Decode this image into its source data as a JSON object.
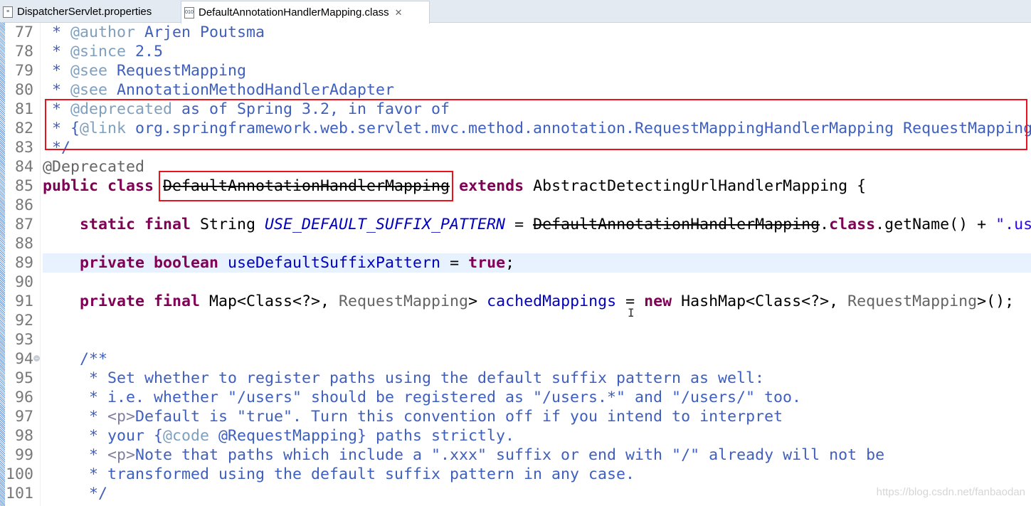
{
  "tabs": [
    {
      "label": "DispatcherServlet.properties",
      "active": false
    },
    {
      "label": "DefaultAnnotationHandlerMapping.class",
      "active": true,
      "icon": "class-file-icon",
      "close": "✕"
    }
  ],
  "editor": {
    "highlighted_line": 89,
    "folded_marker_line": 94,
    "lines": [
      {
        "n": "77",
        "tokens": [
          [
            " * ",
            "jd"
          ],
          [
            "@author",
            "tag"
          ],
          [
            " Arjen Poutsma",
            "jd"
          ]
        ]
      },
      {
        "n": "78",
        "tokens": [
          [
            " * ",
            "jd"
          ],
          [
            "@since",
            "tag"
          ],
          [
            " 2.5",
            "jd"
          ]
        ]
      },
      {
        "n": "79",
        "tokens": [
          [
            " * ",
            "jd"
          ],
          [
            "@see",
            "tag"
          ],
          [
            " RequestMapping",
            "jd"
          ]
        ]
      },
      {
        "n": "80",
        "tokens": [
          [
            " * ",
            "jd"
          ],
          [
            "@see",
            "tag"
          ],
          [
            " AnnotationMethodHandlerAdapter",
            "jd"
          ]
        ]
      },
      {
        "n": "81",
        "tokens": [
          [
            " * ",
            "jd"
          ],
          [
            "@deprecated",
            "tag"
          ],
          [
            " as of Spring 3.2, in favor of",
            "jd"
          ]
        ]
      },
      {
        "n": "82",
        "tokens": [
          [
            " * {",
            "jd"
          ],
          [
            "@link",
            "tag"
          ],
          [
            " org.springframework.web.servlet.mvc.method.annotation.RequestMappingHandlerMapping RequestMapping",
            "jd"
          ]
        ]
      },
      {
        "n": "83",
        "tokens": [
          [
            " */",
            "jd"
          ]
        ]
      },
      {
        "n": "84",
        "tokens": [
          [
            "@Deprecated",
            "ann"
          ]
        ]
      },
      {
        "n": "85",
        "tokens": [
          [
            "public class ",
            "kw"
          ],
          [
            "DefaultAnnotationHandlerMapping",
            "dep"
          ],
          [
            " ",
            "pl"
          ],
          [
            "extends",
            "kw"
          ],
          [
            " AbstractDetectingUrlHandlerMapping {",
            "pl"
          ]
        ]
      },
      {
        "n": "86",
        "tokens": []
      },
      {
        "n": "87",
        "tokens": [
          [
            "    ",
            "pl"
          ],
          [
            "static final",
            "kw"
          ],
          [
            " String ",
            "pl"
          ],
          [
            "USE_DEFAULT_SUFFIX_PATTERN",
            "fld"
          ],
          [
            " = ",
            "pl"
          ],
          [
            "DefaultAnnotationHandlerMapping",
            "dep"
          ],
          [
            ".",
            "pl"
          ],
          [
            "class",
            "kw"
          ],
          [
            ".getName() + ",
            "pl"
          ],
          [
            "\".use",
            "str"
          ]
        ]
      },
      {
        "n": "88",
        "tokens": []
      },
      {
        "n": "89",
        "tokens": [
          [
            "    ",
            "pl"
          ],
          [
            "private boolean",
            "kw"
          ],
          [
            " ",
            "pl"
          ],
          [
            "useDefaultSuffixPattern",
            "var"
          ],
          [
            " = ",
            "pl"
          ],
          [
            "true",
            "kw"
          ],
          [
            ";",
            "pl"
          ]
        ]
      },
      {
        "n": "90",
        "tokens": []
      },
      {
        "n": "91",
        "tokens": [
          [
            "    ",
            "pl"
          ],
          [
            "private final",
            "kw"
          ],
          [
            " Map<Class<?>, ",
            "pl"
          ],
          [
            "RequestMapping",
            "gry"
          ],
          [
            "> ",
            "pl"
          ],
          [
            "cachedMappings",
            "var"
          ],
          [
            " = ",
            "pl"
          ],
          [
            "new",
            "kw"
          ],
          [
            " HashMap<Class<?>, ",
            "pl"
          ],
          [
            "RequestMapping",
            "gry"
          ],
          [
            ">();",
            "pl"
          ]
        ]
      },
      {
        "n": "92",
        "tokens": []
      },
      {
        "n": "93",
        "tokens": []
      },
      {
        "n": "94",
        "tokens": [
          [
            "    /**",
            "jd"
          ]
        ]
      },
      {
        "n": "95",
        "tokens": [
          [
            "     * Set whether to register paths using the default suffix pattern as well:",
            "jd"
          ]
        ]
      },
      {
        "n": "96",
        "tokens": [
          [
            "     * i.e. whether \"/users\" should be registered as \"/users.*\" and \"/users/\" too.",
            "jd"
          ]
        ]
      },
      {
        "n": "97",
        "tokens": [
          [
            "     * ",
            "jd"
          ],
          [
            "<p>",
            "htm"
          ],
          [
            "Default is \"true\". Turn this convention off if you intend to interpret",
            "jd"
          ]
        ]
      },
      {
        "n": "98",
        "tokens": [
          [
            "     * your {",
            "jd"
          ],
          [
            "@code",
            "tag"
          ],
          [
            " @RequestMapping} paths strictly.",
            "jd"
          ]
        ]
      },
      {
        "n": "99",
        "tokens": [
          [
            "     * ",
            "jd"
          ],
          [
            "<p>",
            "htm"
          ],
          [
            "Note that paths which include a \".xxx\" suffix or end with \"/\" already will not be",
            "jd"
          ]
        ]
      },
      {
        "n": "100",
        "tokens": [
          [
            "     * transformed using the default suffix pattern in any case.",
            "jd"
          ]
        ]
      },
      {
        "n": "101",
        "tokens": [
          [
            "     */",
            "jd"
          ]
        ]
      }
    ]
  },
  "colors": {
    "annotation_box": "#E8141B",
    "current_line": "#E8F2FE",
    "keyword": "#7F0055",
    "javadoc": "#3F5FBF"
  },
  "watermark": "https://blog.csdn.net/fanbaodan"
}
